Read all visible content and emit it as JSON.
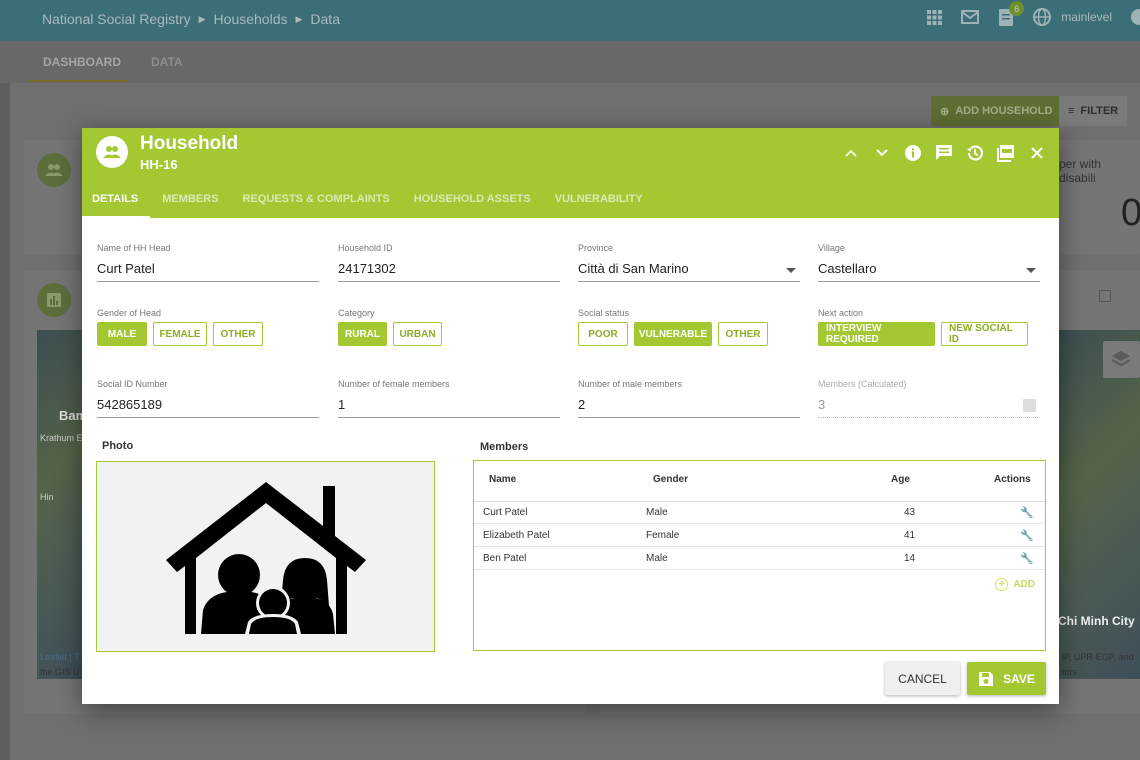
{
  "breadcrumb": {
    "app": "National Social Registry",
    "section": "Households",
    "page": "Data"
  },
  "topbar": {
    "notification_count": "6",
    "username": "mainlevel"
  },
  "subnav": {
    "tabs": [
      "DASHBOARD",
      "DATA"
    ]
  },
  "background": {
    "add_household": "ADD HOUSEHOLD",
    "filter": "FILTER",
    "card_title_fragment": "per with disabili",
    "card_value_fragment": "0",
    "map_labels": [
      "Leaflet | T",
      "the GIS U",
      "iP, UPR-EGP, and",
      "tors",
      "Chi Minh City",
      "Bam",
      "Krathum E",
      "Hin"
    ]
  },
  "dialog": {
    "title": "Household",
    "subtitle": "HH-16",
    "tabs": [
      "DETAILS",
      "MEMBERS",
      "REQUESTS & COMPLAINTS",
      "HOUSEHOLD ASSETS",
      "VULNERABILITY"
    ],
    "fields": {
      "hh_head": {
        "label": "Name of HH Head",
        "value": "Curt Patel"
      },
      "household_id": {
        "label": "Household ID",
        "value": "24171302"
      },
      "province": {
        "label": "Province",
        "value": "Città di San Marino"
      },
      "village": {
        "label": "Village",
        "value": "Castellaro"
      },
      "social_id": {
        "label": "Social ID Number",
        "value": "542865189"
      },
      "female_members": {
        "label": "Number of female members",
        "value": "1"
      },
      "male_members": {
        "label": "Number of male members",
        "value": "2"
      },
      "members_calc": {
        "label": "Members (Calculated)",
        "value": "3"
      }
    },
    "gender": {
      "label": "Gender of Head",
      "options": [
        "MALE",
        "FEMALE",
        "OTHER"
      ],
      "selected": "MALE"
    },
    "category": {
      "label": "Category",
      "options": [
        "RURAL",
        "URBAN"
      ],
      "selected": "RURAL"
    },
    "social_status": {
      "label": "Social status",
      "options": [
        "POOR",
        "VULNERABLE",
        "OTHER"
      ],
      "selected": "VULNERABLE"
    },
    "next_action": {
      "label": "Next action",
      "options": [
        "INTERVIEW REQUIRED",
        "NEW SOCIAL ID"
      ],
      "selected": "INTERVIEW REQUIRED"
    },
    "photo_label": "Photo",
    "members": {
      "label": "Members",
      "columns": [
        "Name",
        "Gender",
        "Age",
        "Actions"
      ],
      "rows": [
        {
          "name": "Curt Patel",
          "gender": "Male",
          "age": "43"
        },
        {
          "name": "Elizabeth Patel",
          "gender": "Female",
          "age": "41"
        },
        {
          "name": "Ben Patel",
          "gender": "Male",
          "age": "14"
        }
      ],
      "add_label": "ADD"
    },
    "buttons": {
      "cancel": "CANCEL",
      "save": "SAVE"
    }
  },
  "colors": {
    "accent": "#a3c832",
    "topbar": "#3c6e78"
  }
}
